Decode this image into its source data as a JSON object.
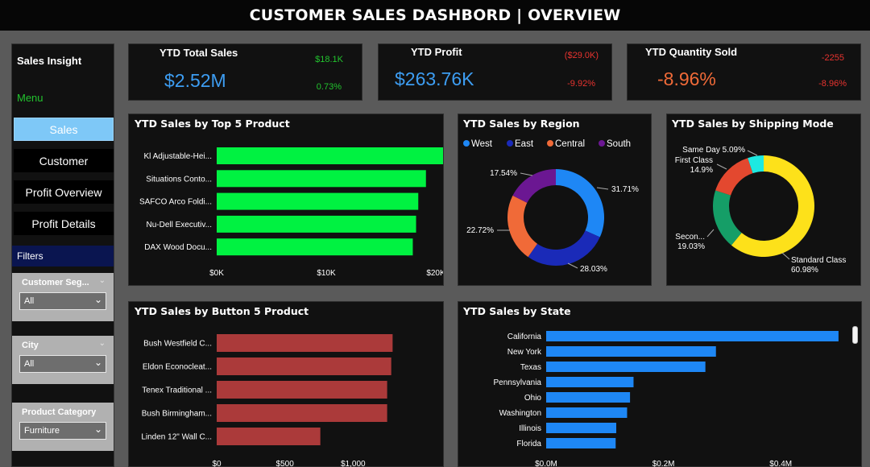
{
  "header": {
    "title": "CUSTOMER SALES DASHBORD | OVERVIEW"
  },
  "sidebar": {
    "title": "Sales Insight",
    "menu_label": "Menu",
    "nav": [
      "Sales",
      "Customer",
      "Profit Overview",
      "Profit Details"
    ],
    "active": "Sales",
    "filters_label": "Filters",
    "filters": [
      {
        "label": "Customer Seg...",
        "value": "All"
      },
      {
        "label": "City",
        "value": "All"
      },
      {
        "label": "Product Category",
        "value": "Furniture"
      }
    ]
  },
  "kpis": [
    {
      "title": "YTD Total Sales",
      "value": "$2.52M",
      "delta_abs": "$18.1K",
      "delta_pct": "0.73%"
    },
    {
      "title": "YTD Profit",
      "value": "$263.76K",
      "delta_abs": "($29.0K)",
      "delta_pct": "-9.92%"
    },
    {
      "title": "YTD Quantity Sold",
      "value": "-8.96%",
      "delta_abs": "-2255",
      "delta_pct": "-8.96%"
    }
  ],
  "colors": {
    "positive": "#22c32e",
    "negative": "#e8332f",
    "value_blue": "#3d9df2",
    "value_orange": "#f06a38",
    "top_bar": "#00f241",
    "bottom_bar": "#ab3a3a",
    "state_bar": "#1e87f5"
  },
  "chart_data": [
    {
      "type": "bar",
      "orientation": "horizontal",
      "title": "YTD Sales by Top 5 Product",
      "categories": [
        "Kl Adjustable-Hei...",
        "Situations Conto...",
        "SAFCO Arco Foldi...",
        "Nu-Dell Executiv...",
        "DAX Wood Docu..."
      ],
      "values": [
        22500,
        19100,
        18400,
        18200,
        17900
      ],
      "xlim": [
        0,
        25000
      ],
      "xticks": [
        "$0K",
        "$10K",
        "$20K"
      ],
      "xtick_values": [
        0,
        10000,
        20000
      ]
    },
    {
      "type": "pie",
      "subtype": "donut",
      "title": "YTD Sales by Region",
      "legend": [
        "West",
        "East",
        "Central",
        "South"
      ],
      "legend_position": "top-left",
      "slices": [
        {
          "label": "West",
          "value": 31.71,
          "display": "31.71%",
          "color": "#1e87f5"
        },
        {
          "label": "East",
          "value": 28.03,
          "display": "28.03%",
          "color": "#1a2ab8"
        },
        {
          "label": "Central",
          "value": 22.72,
          "display": "22.72%",
          "color": "#f06a38"
        },
        {
          "label": "South",
          "value": 17.54,
          "display": "17.54%",
          "color": "#6b1792"
        }
      ]
    },
    {
      "type": "pie",
      "subtype": "donut",
      "title": "YTD Sales by Shipping Mode",
      "slices": [
        {
          "label": "Standard Class",
          "value": 60.98,
          "display": "60.98%",
          "color": "#fde11a"
        },
        {
          "label": "Secon...",
          "value": 19.03,
          "display": "19.03%",
          "color": "#159e67"
        },
        {
          "label": "First Class",
          "value": 14.9,
          "display": "14.9%",
          "color": "#e3482f"
        },
        {
          "label": "Same Day",
          "value": 5.09,
          "display": "5.09%",
          "color": "#1de9e1"
        }
      ]
    },
    {
      "type": "bar",
      "orientation": "horizontal",
      "title": "YTD Sales by Button 5 Product",
      "categories": [
        "Bush Westfield C...",
        "Eldon Econocleat...",
        "Tenex Traditional ...",
        "Bush Birmingham...",
        "Linden 12\" Wall C..."
      ],
      "values": [
        1290,
        1280,
        1250,
        1250,
        760
      ],
      "xlim": [
        0,
        1400
      ],
      "xticks": [
        "$0",
        "$500",
        "$1,000"
      ],
      "xtick_values": [
        0,
        500,
        1000
      ]
    },
    {
      "type": "bar",
      "orientation": "horizontal",
      "title": "YTD Sales by State",
      "categories": [
        "California",
        "New York",
        "Texas",
        "Pennsylvania",
        "Ohio",
        "Washington",
        "Illinois",
        "Florida"
      ],
      "values": [
        0.4985,
        0.2895,
        0.2715,
        0.149,
        0.143,
        0.138,
        0.1195,
        0.1185
      ],
      "xlim": [
        0,
        0.5
      ],
      "xticks": [
        "$0.0M",
        "$0.2M",
        "$0.4M"
      ],
      "xtick_values": [
        0,
        0.2,
        0.4
      ]
    }
  ]
}
